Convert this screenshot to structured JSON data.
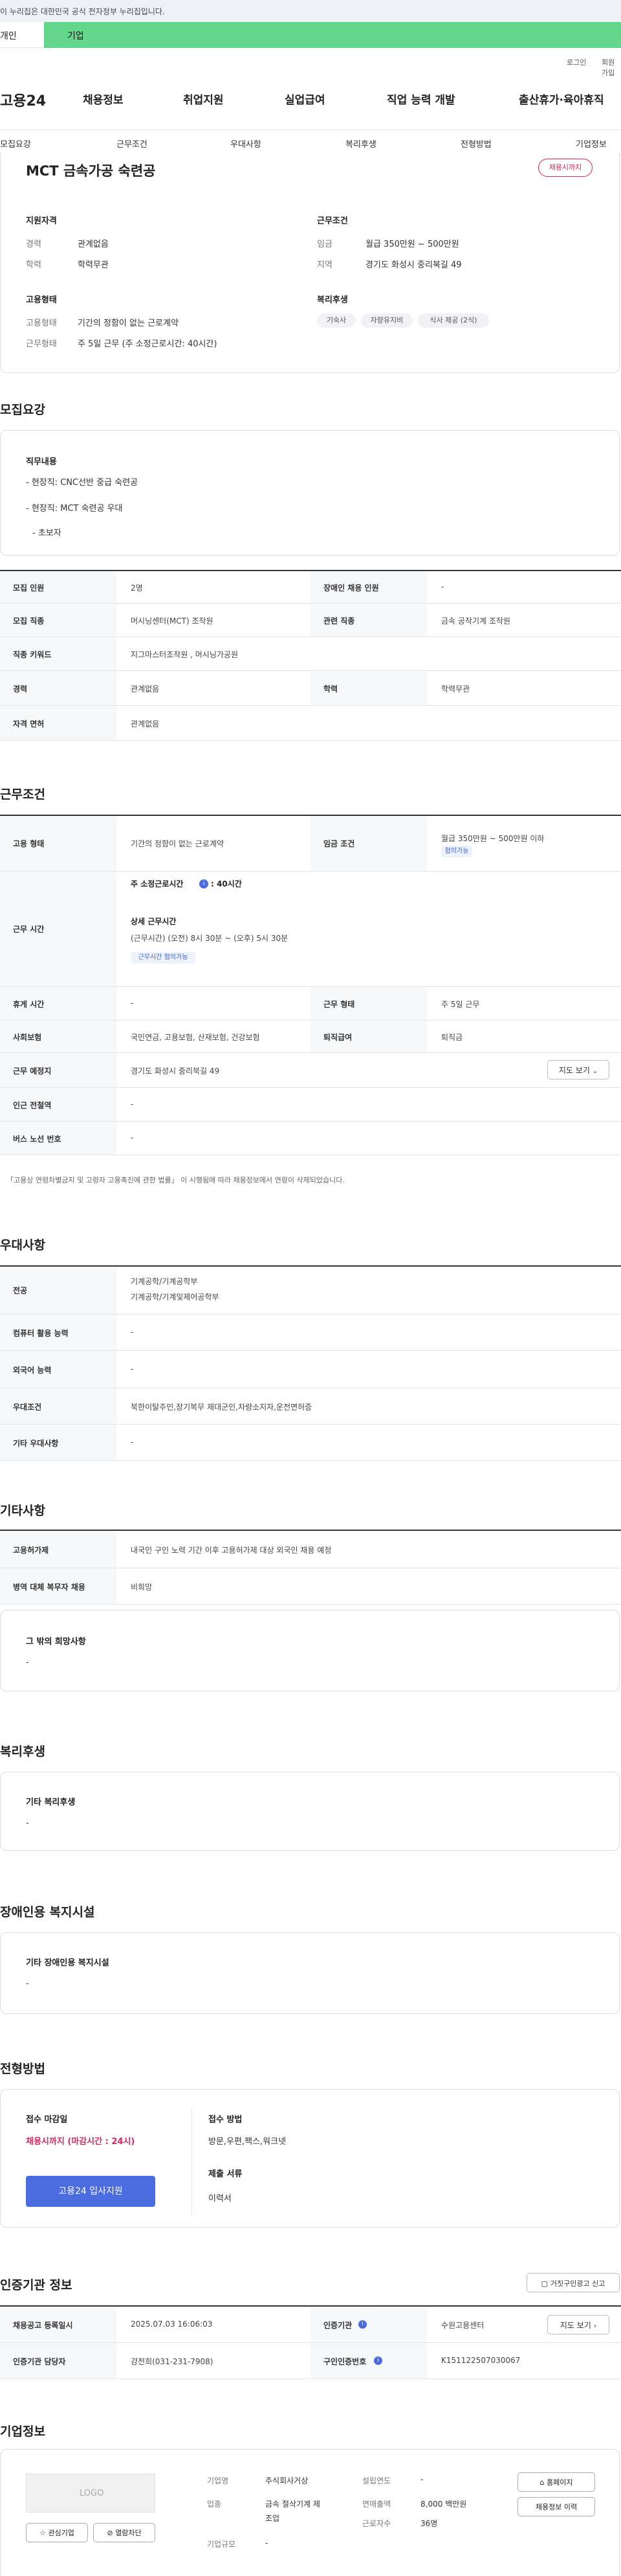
{
  "gov_banner": "이 누리집은 대한민국 공식 전자정부 누리집입니다.",
  "user_tabs": {
    "personal": "개인",
    "company": "기업"
  },
  "util": {
    "login": "로그인",
    "join": "회원가입"
  },
  "logo": "고용24",
  "gnb": [
    "채용정보",
    "취업지원",
    "실업급여",
    "직업 능력 개발",
    "출산휴가·육아휴직"
  ],
  "sub_nav": [
    "모집요강",
    "근무조건",
    "우대사항",
    "복리후생",
    "전형방법",
    "기업정보"
  ],
  "summary": {
    "title": "MCT 금속가공 숙련공",
    "status_badge": "채용시까지",
    "qualification_label": "지원자격",
    "career_label": "경력",
    "career_value": "관계없음",
    "education_label": "학력",
    "education_value": "학력무관",
    "conditions_label": "근무조건",
    "wage_label": "임금",
    "wage_value": "월급 350만원 ~ 500만원",
    "region_label": "지역",
    "region_value": "경기도 화성시 중리북길 49",
    "employment_label": "고용형태",
    "emp_type_label": "고용형태",
    "emp_type_value": "기간의 정함이 없는 근로계약",
    "work_type_label": "근무형태",
    "work_type_value": "주 5일 근무 (주 소정근로시간: 40시간)",
    "welfare_label": "복리후생",
    "welfare_chips": [
      "기숙사",
      "자량유지비",
      "식사 제공 (2식)"
    ]
  },
  "recruit": {
    "section_title": "모집요강",
    "duty_title": "직무내용",
    "duty_lines": [
      "- 현장직: CNC선반 중급 숙련공",
      "- 현장직: MCT 숙련공 우대",
      "- 초보자"
    ],
    "rows": [
      {
        "l1": "모집 인원",
        "v1": "2명",
        "l2": "장애인 채용 인원",
        "v2": "-"
      },
      {
        "l1": "모집 직종",
        "v1": "머시닝센터(MCT) 조작원",
        "l2": "관련 직종",
        "v2": "금속 공작기계 조작원"
      },
      {
        "l1": "직종 키워드",
        "v1": "지그마스터조작원 , 머시닝가공원"
      },
      {
        "l1": "경력",
        "v1": "관계없음",
        "l2": "학력",
        "v2": "학력무관"
      },
      {
        "l1": "자격 면허",
        "v1": "관계없음"
      }
    ]
  },
  "work": {
    "section_title": "근무조건",
    "emp_type_label": "고용 형태",
    "emp_type_value": "기간의 정함이 없는 근로계약",
    "wage_label": "임금 조건",
    "wage_value": "월급 350만원 ~ 500만원 이하",
    "wage_badge": "협의가능",
    "hours_label": "근무 시간",
    "hours_main": "주 소정근로시간",
    "hours_main_value": ": 40시간",
    "hours_detail_title": "상세 근무시간",
    "hours_detail": "(근무시간) (오전) 8시 30분 ~ (오후) 5시 30분",
    "hours_badge": "근무시간 협의가능",
    "rest_label": "휴게 시간",
    "rest_value": "-",
    "work_form_label": "근무 형태",
    "work_form_value": "주 5일 근무",
    "insurance_label": "사회보험",
    "insurance_value": "국민연금, 고용보험, 산재보험, 건강보험",
    "retire_label": "퇴직급여",
    "retire_value": "퇴직금",
    "place_label": "근무 예정지",
    "place_value": "경기도 화성시 중리북길 49",
    "map_button": "지도 보기",
    "subway_label": "인근 전철역",
    "subway_value": "-",
    "bus_label": "버스 노선 번호",
    "bus_value": "-",
    "note": "「고용상 연령차별금지 및 고령자 고용촉진에 관한 법률」 이 시행됨에 따라 채용정보에서 연령이 삭제되었습니다."
  },
  "pref": {
    "section_title": "우대사항",
    "major_label": "전공",
    "major_lines": [
      "기계공학/기계공학부",
      "기계공학/기계및제어공학부"
    ],
    "computer_label": "컴퓨터 활용 능력",
    "computer_value": "-",
    "language_label": "외국어 능력",
    "language_value": "-",
    "cond_label": "우대조건",
    "cond_value": "북한이탈주민,장기복무 제대군인,차량소지자,운전면허증",
    "other_label": "기타 우대사항",
    "other_value": "-"
  },
  "etc": {
    "section_title": "기타사항",
    "foreign_label": "고용허가제",
    "foreign_value": "내국인 구인 노력 기간 이후 고용허가제 대상 외국인 채용 예정",
    "military_label": "병역 대체 복무자 채용",
    "military_value": "비희망",
    "other_title": "그 밖의 희망사항",
    "other_value": "-"
  },
  "welfare": {
    "section_title": "복리후생",
    "box_title": "기타 복리후생",
    "box_value": "-"
  },
  "disabled": {
    "section_title": "장애인용 복지시설",
    "box_title": "기타 장애인용 복지시설",
    "box_value": "-"
  },
  "selection": {
    "section_title": "전형방법",
    "deadline_label": "접수 마감일",
    "deadline_value": "채용시까지 (마감시간 : 24시)",
    "apply_button": "고용24 입사지원",
    "method_label": "접수 방법",
    "method_value": "방문,우편,팩스,워크넷",
    "docs_label": "제출 서류",
    "docs_value": "이력서"
  },
  "agency": {
    "section_title": "인증기관 정보",
    "report_button": "거짓구인광고 신고",
    "reg_date_label": "채용공고 등록일시",
    "reg_date_value": "2025.07.03 16:06:03",
    "agency_label": "인증기관",
    "agency_value": "수원고용센터",
    "map_button": "지도 보기",
    "manager_label": "인증기관 담당자",
    "manager_value": "강전희(031-231-7908)",
    "job_no_label": "구인인증번호",
    "job_no_value": "K151122507030067"
  },
  "company": {
    "section_title": "기업정보",
    "logo_placeholder": "LOGO",
    "interest_button": "관심기업",
    "block_button": "열람차단",
    "name_label": "기업명",
    "name_value": "주식회사거상",
    "industry_label": "업종",
    "industry_line1": "금속 절삭기계 제",
    "industry_line2": "조업",
    "size_label": "기업규모",
    "size_value": "-",
    "founded_label": "설립연도",
    "founded_value": "-",
    "sales_label": "연매출액",
    "sales_value": "8,000 백만원",
    "staff_label": "근로자수",
    "staff_value": "36명",
    "homepage_button": "홈페이지",
    "jobs_button": "채용정보 이력"
  },
  "colors": {
    "brand_green": "#63d68c",
    "badge_red": "#e0245e",
    "apply_blue": "#4a6ce0"
  }
}
